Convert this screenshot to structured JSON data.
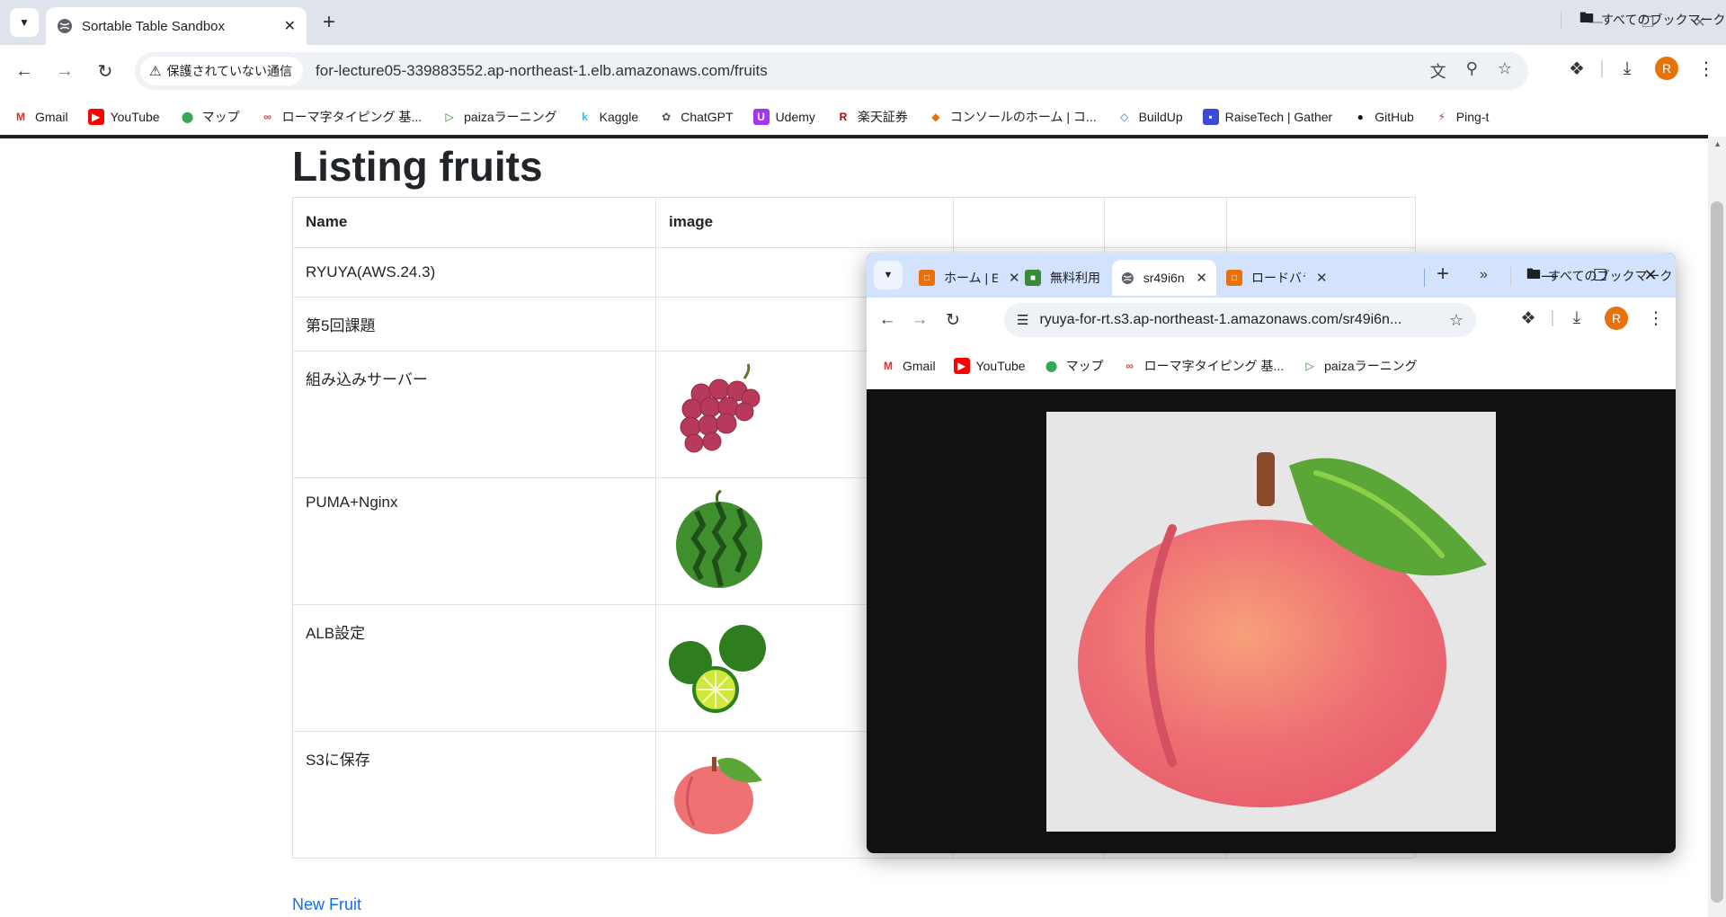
{
  "browser": {
    "tab_title": "Sortable Table Sandbox",
    "security_label": "保護されていない通信",
    "url": "for-lecture05-339883552.ap-northeast-1.elb.amazonaws.com/fruits",
    "avatar_letter": "R",
    "bookmarks": [
      {
        "label": "Gmail",
        "icon": "gmail-icon"
      },
      {
        "label": "YouTube",
        "icon": "youtube-icon"
      },
      {
        "label": "マップ",
        "icon": "maps-icon"
      },
      {
        "label": "ローマ字タイピング 基...",
        "icon": "typing-icon"
      },
      {
        "label": "paizaラーニング",
        "icon": "paiza-icon"
      },
      {
        "label": "Kaggle",
        "icon": "kaggle-icon"
      },
      {
        "label": "ChatGPT",
        "icon": "chatgpt-icon"
      },
      {
        "label": "Udemy",
        "icon": "udemy-icon"
      },
      {
        "label": "楽天証券",
        "icon": "rakuten-icon"
      },
      {
        "label": "コンソールのホーム | コ...",
        "icon": "aws-icon"
      },
      {
        "label": "BuildUp",
        "icon": "buildup-icon"
      },
      {
        "label": "RaiseTech | Gather",
        "icon": "gather-icon"
      },
      {
        "label": "GitHub",
        "icon": "github-icon"
      },
      {
        "label": "Ping-t",
        "icon": "pingt-icon"
      }
    ],
    "all_bookmarks_label": "すべてのブックマーク"
  },
  "page": {
    "title": "Listing fruits",
    "columns": [
      "Name",
      "image"
    ],
    "rows": [
      {
        "name": "RYUYA(AWS.24.3)",
        "image": ""
      },
      {
        "name": "第5回課題",
        "image": ""
      },
      {
        "name": "組み込みサーバー",
        "image": "grapes"
      },
      {
        "name": "PUMA+Nginx",
        "image": "watermelon"
      },
      {
        "name": "ALB設定",
        "image": "limes"
      },
      {
        "name": "S3に保存",
        "image": "peach"
      }
    ],
    "new_link": "New Fruit"
  },
  "popup": {
    "tabs": [
      {
        "label": "ホーム | E",
        "icon": "aws-icon"
      },
      {
        "label": "無料利用",
        "icon": "free-tier-icon"
      },
      {
        "label": "sr49i6n",
        "icon": "globe-icon"
      },
      {
        "label": "ロードバラ",
        "icon": "aws-icon"
      }
    ],
    "url": "ryuya-for-rt.s3.ap-northeast-1.amazonaws.com/sr49i6n...",
    "avatar_letter": "R",
    "bookmarks": [
      {
        "label": "Gmail",
        "icon": "gmail-icon"
      },
      {
        "label": "YouTube",
        "icon": "youtube-icon"
      },
      {
        "label": "マップ",
        "icon": "maps-icon"
      },
      {
        "label": "ローマ字タイピング 基...",
        "icon": "typing-icon"
      },
      {
        "label": "paizaラーニング",
        "icon": "paiza-icon"
      }
    ],
    "all_bookmarks_label": "すべてのブックマーク",
    "image_name": "peach"
  }
}
